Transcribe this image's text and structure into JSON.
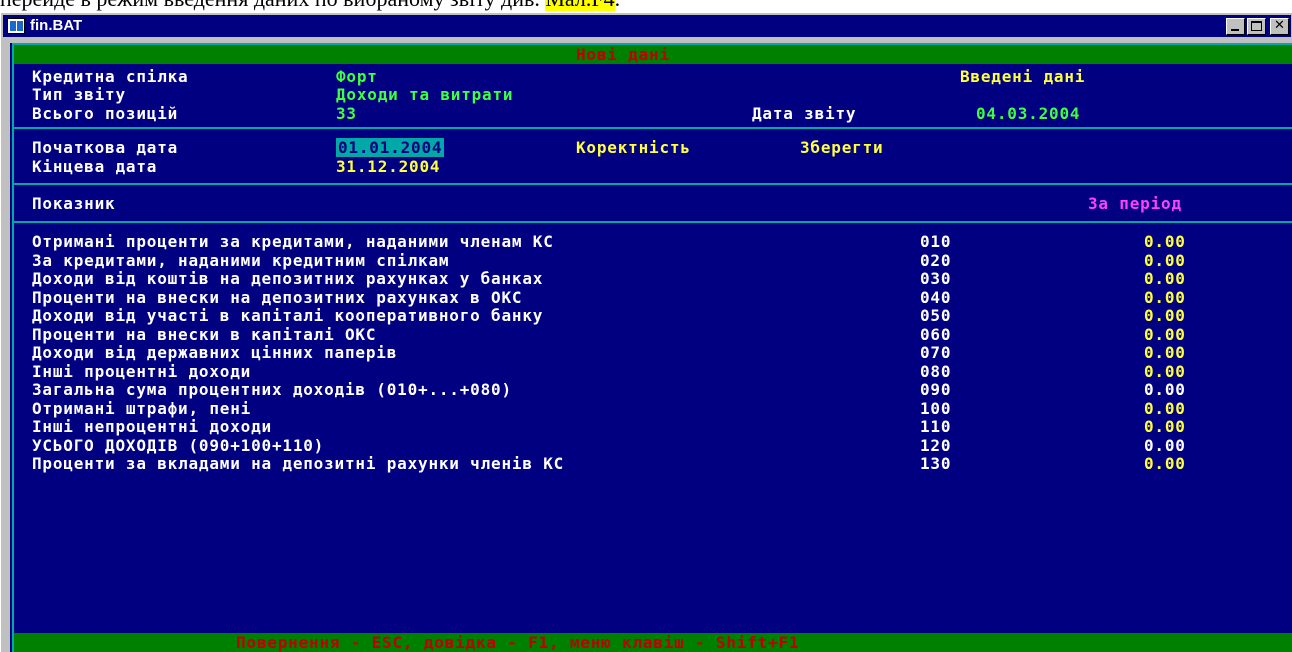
{
  "doc": {
    "text_before": "перейде в режим введення даних по вибраному звіту див. ",
    "highlight": "Мал.F4",
    "text_after": "."
  },
  "window": {
    "title": "fin.BAT",
    "controls": {
      "minimize": "_",
      "maximize": "□",
      "close": "✕"
    }
  },
  "header": {
    "title": "Нові дані"
  },
  "info": {
    "union_label": "Кредитна спілка",
    "union_value": "Форт",
    "status": "Введені дані",
    "report_type_label": "Тип звіту",
    "report_type_value": "Доходи та витрати",
    "positions_label": "Всього позицій",
    "positions_value": "33",
    "report_date_label": "Дата звіту",
    "report_date_value": "04.03.2004"
  },
  "period": {
    "start_label": "Початкова дата",
    "start_value": "01.01.2004",
    "end_label": "Кінцева дата",
    "end_value": "31.12.2004",
    "correctness_button": "Коректність",
    "save_button": "Зберегти"
  },
  "table": {
    "indicator_header": "Показник",
    "period_header": "За період",
    "rows": [
      {
        "label": "Отримані проценти за кредитами, наданими членам КС",
        "code": "010",
        "value": "0.00",
        "editable": true
      },
      {
        "label": "За кредитами, наданими кредитним спілкам",
        "code": "020",
        "value": "0.00",
        "editable": true
      },
      {
        "label": "Доходи від коштів на депозитних рахунках у банках",
        "code": "030",
        "value": "0.00",
        "editable": true
      },
      {
        "label": "Проценти на внески на депозитних рахунках в ОКС",
        "code": "040",
        "value": "0.00",
        "editable": true
      },
      {
        "label": "Доходи від участі в капіталі кооперативного банку",
        "code": "050",
        "value": "0.00",
        "editable": true
      },
      {
        "label": "Проценти на внески в капіталі ОКС",
        "code": "060",
        "value": "0.00",
        "editable": true
      },
      {
        "label": "Доходи від державних цінних паперів",
        "code": "070",
        "value": "0.00",
        "editable": true
      },
      {
        "label": "Інші процентні доходи",
        "code": "080",
        "value": "0.00",
        "editable": true
      },
      {
        "label": "Загальна сума процентних доходів (010+...+080)",
        "code": "090",
        "value": "0.00",
        "editable": false
      },
      {
        "label": "Отримані штрафи, пені",
        "code": "100",
        "value": "0.00",
        "editable": true
      },
      {
        "label": "Інші непроцентні доходи",
        "code": "110",
        "value": "0.00",
        "editable": true
      },
      {
        "label": "УСЬОГО ДОХОДІВ (090+100+110)",
        "code": "120",
        "value": "0.00",
        "editable": false
      },
      {
        "label": "Проценти за вкладами на депозитні рахунки членів КС",
        "code": "130",
        "value": "0.00",
        "editable": true
      }
    ]
  },
  "footer": {
    "hint": "Повернення - ESC, довідка - F1, меню клавіш - Shift+F1"
  },
  "colors": {
    "console_bg": "#000080",
    "frame": "#00a8a8",
    "header_bar": "#008000",
    "header_text": "#c00000",
    "label": "#ffffff",
    "value_green": "#40ff40",
    "value_yellow": "#ffff40",
    "period_header": "#ff40ff"
  },
  "icons": {
    "app": "app-window-icon"
  }
}
